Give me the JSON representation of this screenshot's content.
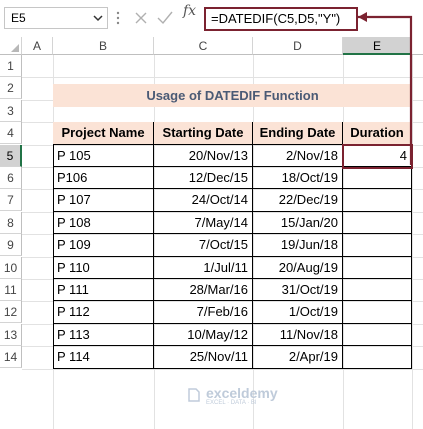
{
  "formula_bar": {
    "name_box": "E5",
    "fx_label": "fx",
    "formula": "=DATEDIF(C5,D5,\"Y\")"
  },
  "columns": [
    "A",
    "B",
    "C",
    "D",
    "E"
  ],
  "rows": [
    "1",
    "2",
    "3",
    "4",
    "5",
    "6",
    "7",
    "8",
    "9",
    "10",
    "11",
    "12",
    "13",
    "14"
  ],
  "sheet": {
    "title": "Usage of DATEDIF Function",
    "headers": [
      "Project Name",
      "Starting Date",
      "Ending Date",
      "Duration"
    ],
    "data": [
      {
        "project": "P 105",
        "start": "20/Nov/13",
        "end": "2/Nov/18",
        "duration": "4"
      },
      {
        "project": "P106",
        "start": "12/Dec/15",
        "end": "18/Oct/19",
        "duration": ""
      },
      {
        "project": "P 107",
        "start": "24/Oct/14",
        "end": "22/Dec/19",
        "duration": ""
      },
      {
        "project": "P 108",
        "start": "7/May/14",
        "end": "15/Jan/20",
        "duration": ""
      },
      {
        "project": "P 109",
        "start": "7/Oct/15",
        "end": "19/Jun/18",
        "duration": ""
      },
      {
        "project": "P 110",
        "start": "1/Jul/11",
        "end": "20/Aug/19",
        "duration": ""
      },
      {
        "project": "P 111",
        "start": "28/Mar/16",
        "end": "31/Oct/19",
        "duration": ""
      },
      {
        "project": "P 112",
        "start": "7/Feb/16",
        "end": "1/Oct/19",
        "duration": ""
      },
      {
        "project": "P 113",
        "start": "10/May/12",
        "end": "11/Nov/18",
        "duration": ""
      },
      {
        "project": "P 114",
        "start": "25/Nov/11",
        "end": "2/Apr/19",
        "duration": ""
      }
    ]
  },
  "watermark": {
    "word": "exceldemy",
    "sub": "EXCEL · DATA · BI"
  },
  "colors": {
    "accent": "#7b2230",
    "header_fill": "#fbe3d6",
    "title_text": "#4a5a75",
    "selection": "#217346"
  }
}
